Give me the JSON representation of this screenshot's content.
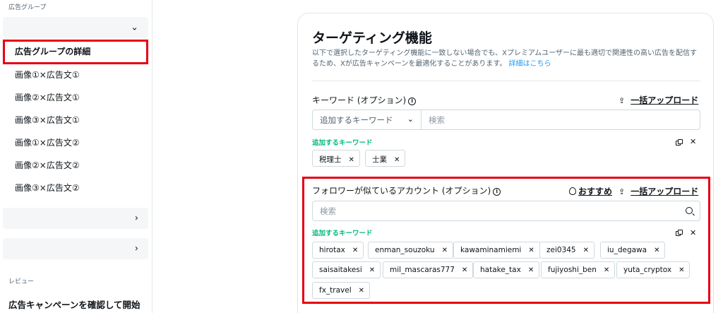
{
  "sidebar": {
    "section_ad_group": "広告グループ",
    "items": [
      {
        "label": "広告グループの詳細",
        "active": true
      },
      {
        "label": "画像①×広告文①"
      },
      {
        "label": "画像②×広告文①"
      },
      {
        "label": "画像③×広告文①"
      },
      {
        "label": "画像①×広告文②"
      },
      {
        "label": "画像②×広告文②"
      },
      {
        "label": "画像③×広告文②"
      }
    ],
    "section_review": "レビュー",
    "review_cta": "広告キャンペーンを確認して開始"
  },
  "targeting": {
    "title": "ターゲティング機能",
    "description": "以下で選択したターゲティング機能に一致しない場合でも、Xプレミアムユーザーに最も適切で関連性の高い広告を配信するため、Xが広告キャンペーンを最適化することがあります。",
    "details_link": "詳細はこちら",
    "keywords": {
      "label": "キーワード (オプション)",
      "bulk_upload": "一括アップロード",
      "select_value": "追加するキーワード",
      "search_placeholder": "検索",
      "added_label": "追加するキーワード",
      "chips": [
        "税理士",
        "士業"
      ]
    },
    "follower_lookalikes": {
      "label": "フォロワーが似ているアカウント (オプション)",
      "recommend": "おすすめ",
      "bulk_upload": "一括アップロード",
      "search_placeholder": "検索",
      "added_label": "追加するキーワード",
      "chips": [
        "hirotax",
        "enman_souzoku",
        "kawaminamiemi",
        "zei0345",
        "iu_degawa",
        "saisaitakesi",
        "mil_mascaras777",
        "hatake_tax",
        "fujiyoshi_ben",
        "yuta_cryptox",
        "fx_travel"
      ]
    }
  },
  "colors": {
    "highlight": "#e60012",
    "added_green": "#00ba7c",
    "link_blue": "#1d9bf0"
  }
}
